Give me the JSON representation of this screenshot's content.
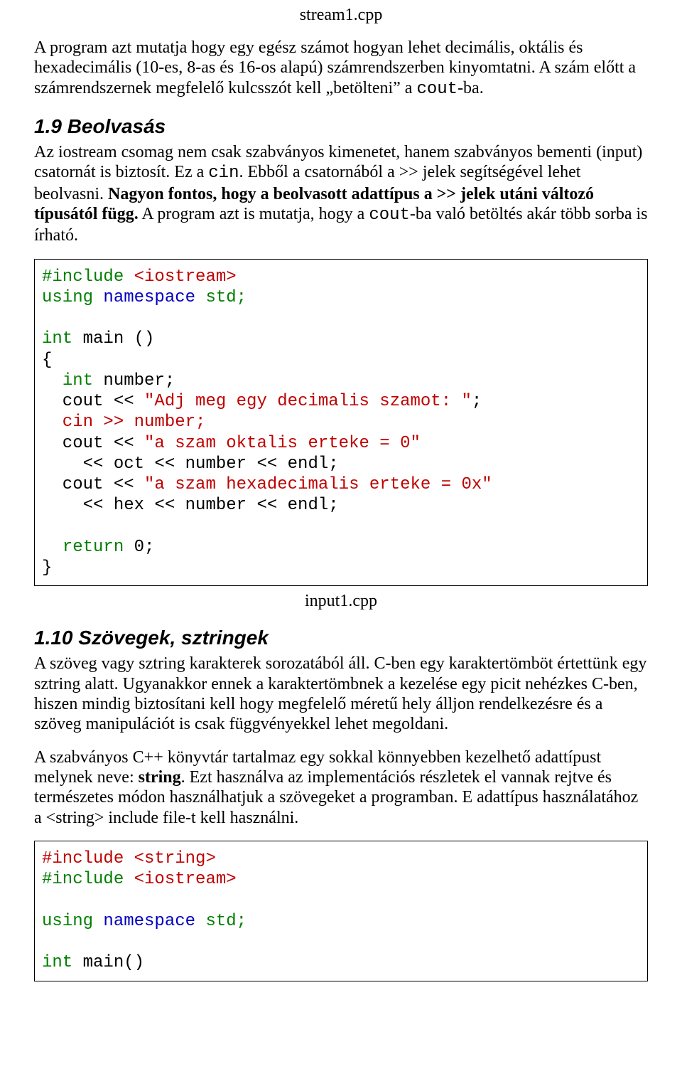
{
  "filename1": "stream1.cpp",
  "intro1_a": "A program azt mutatja hogy egy egész számot hogyan lehet decimális, oktális és hexadecimális (10-es, 8-as és 16-os alapú) számrendszerben kinyomtatni. A szám előtt a számrendszernek megfelelő kulcsszót kell „betölteni” a ",
  "intro1_cout": "cout",
  "intro1_b": "-ba.",
  "h1": "1.9 Beolvasás",
  "p2_a": "Az iostream csomag nem csak szabványos kimenetet, hanem szabványos bementi (input) csatornát is biztosít. Ez a ",
  "p2_cin": "cin",
  "p2_b": ". Ebből a csatornából a >> jelek segítségével lehet beolvasni. ",
  "p2_bold": "Nagyon fontos, hogy a beolvasott adattípus a >> jelek utáni változó típusától függ.",
  "p2_c": " A program azt is mutatja, hogy a ",
  "p2_cout": "cout",
  "p2_d": "-ba való betöltés akár több sorba is írható.",
  "code1": {
    "l1a": "#include ",
    "l1b": "<iostream>",
    "l2a": "using ",
    "l2b": "namespace",
    "l2c": " std;",
    "l3": "",
    "l4a": "int",
    "l4b": " main ()",
    "l5": "{",
    "l6a": "  ",
    "l6b": "int",
    "l6c": " number;",
    "l7a": "  cout << ",
    "l7b": "\"Adj meg egy decimalis szamot: \"",
    "l7c": ";",
    "l8a": "  cin >> number;",
    "l9a": "  cout << ",
    "l9b": "\"a szam oktalis erteke = 0\"",
    "l10": "    << oct << number << endl;",
    "l11a": "  cout << ",
    "l11b": "\"a szam hexadecimalis erteke = 0x\"",
    "l12": "    << hex << number << endl;",
    "l13": "",
    "l14a": "  ",
    "l14b": "return",
    "l14c": " 0;",
    "l15": "}"
  },
  "filename2": "input1.cpp",
  "h2": "1.10 Szövegek, sztringek",
  "p3": "A szöveg vagy sztring karakterek sorozatából áll. C-ben egy karaktertömböt értettünk egy sztring alatt. Ugyanakkor ennek a karaktertömbnek a kezelése egy picit nehézkes C-ben, hiszen mindig biztosítani kell hogy megfelelő méretű hely álljon rendelkezésre és a szöveg manipulációt is csak függvényekkel lehet megoldani.",
  "p4_a": "A szabványos C++ könyvtár tartalmaz egy sokkal könnyebben kezelhető adattípust melynek neve: ",
  "p4_string": "string",
  "p4_b": ". Ezt használva az implementációs részletek el vannak rejtve és természetes módon használhatjuk a szövegeket a programban. E adattípus használatához a <string> include file-t kell használni.",
  "code2": {
    "l1a": "#include ",
    "l1b": "<string>",
    "l2a": "#include ",
    "l2b": "<iostream>",
    "l3": "",
    "l4a": "using ",
    "l4b": "namespace",
    "l4c": " std;",
    "l5": "",
    "l6a": "int",
    "l6b": " main()"
  }
}
